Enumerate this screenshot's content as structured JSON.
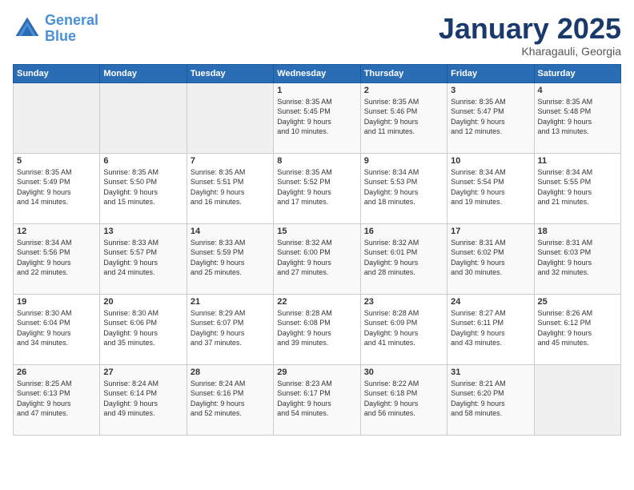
{
  "logo": {
    "line1": "General",
    "line2": "Blue"
  },
  "header": {
    "month": "January 2025",
    "location": "Kharagauli, Georgia"
  },
  "weekdays": [
    "Sunday",
    "Monday",
    "Tuesday",
    "Wednesday",
    "Thursday",
    "Friday",
    "Saturday"
  ],
  "weeks": [
    [
      {
        "day": "",
        "info": ""
      },
      {
        "day": "",
        "info": ""
      },
      {
        "day": "",
        "info": ""
      },
      {
        "day": "1",
        "info": "Sunrise: 8:35 AM\nSunset: 5:45 PM\nDaylight: 9 hours\nand 10 minutes."
      },
      {
        "day": "2",
        "info": "Sunrise: 8:35 AM\nSunset: 5:46 PM\nDaylight: 9 hours\nand 11 minutes."
      },
      {
        "day": "3",
        "info": "Sunrise: 8:35 AM\nSunset: 5:47 PM\nDaylight: 9 hours\nand 12 minutes."
      },
      {
        "day": "4",
        "info": "Sunrise: 8:35 AM\nSunset: 5:48 PM\nDaylight: 9 hours\nand 13 minutes."
      }
    ],
    [
      {
        "day": "5",
        "info": "Sunrise: 8:35 AM\nSunset: 5:49 PM\nDaylight: 9 hours\nand 14 minutes."
      },
      {
        "day": "6",
        "info": "Sunrise: 8:35 AM\nSunset: 5:50 PM\nDaylight: 9 hours\nand 15 minutes."
      },
      {
        "day": "7",
        "info": "Sunrise: 8:35 AM\nSunset: 5:51 PM\nDaylight: 9 hours\nand 16 minutes."
      },
      {
        "day": "8",
        "info": "Sunrise: 8:35 AM\nSunset: 5:52 PM\nDaylight: 9 hours\nand 17 minutes."
      },
      {
        "day": "9",
        "info": "Sunrise: 8:34 AM\nSunset: 5:53 PM\nDaylight: 9 hours\nand 18 minutes."
      },
      {
        "day": "10",
        "info": "Sunrise: 8:34 AM\nSunset: 5:54 PM\nDaylight: 9 hours\nand 19 minutes."
      },
      {
        "day": "11",
        "info": "Sunrise: 8:34 AM\nSunset: 5:55 PM\nDaylight: 9 hours\nand 21 minutes."
      }
    ],
    [
      {
        "day": "12",
        "info": "Sunrise: 8:34 AM\nSunset: 5:56 PM\nDaylight: 9 hours\nand 22 minutes."
      },
      {
        "day": "13",
        "info": "Sunrise: 8:33 AM\nSunset: 5:57 PM\nDaylight: 9 hours\nand 24 minutes."
      },
      {
        "day": "14",
        "info": "Sunrise: 8:33 AM\nSunset: 5:59 PM\nDaylight: 9 hours\nand 25 minutes."
      },
      {
        "day": "15",
        "info": "Sunrise: 8:32 AM\nSunset: 6:00 PM\nDaylight: 9 hours\nand 27 minutes."
      },
      {
        "day": "16",
        "info": "Sunrise: 8:32 AM\nSunset: 6:01 PM\nDaylight: 9 hours\nand 28 minutes."
      },
      {
        "day": "17",
        "info": "Sunrise: 8:31 AM\nSunset: 6:02 PM\nDaylight: 9 hours\nand 30 minutes."
      },
      {
        "day": "18",
        "info": "Sunrise: 8:31 AM\nSunset: 6:03 PM\nDaylight: 9 hours\nand 32 minutes."
      }
    ],
    [
      {
        "day": "19",
        "info": "Sunrise: 8:30 AM\nSunset: 6:04 PM\nDaylight: 9 hours\nand 34 minutes."
      },
      {
        "day": "20",
        "info": "Sunrise: 8:30 AM\nSunset: 6:06 PM\nDaylight: 9 hours\nand 35 minutes."
      },
      {
        "day": "21",
        "info": "Sunrise: 8:29 AM\nSunset: 6:07 PM\nDaylight: 9 hours\nand 37 minutes."
      },
      {
        "day": "22",
        "info": "Sunrise: 8:28 AM\nSunset: 6:08 PM\nDaylight: 9 hours\nand 39 minutes."
      },
      {
        "day": "23",
        "info": "Sunrise: 8:28 AM\nSunset: 6:09 PM\nDaylight: 9 hours\nand 41 minutes."
      },
      {
        "day": "24",
        "info": "Sunrise: 8:27 AM\nSunset: 6:11 PM\nDaylight: 9 hours\nand 43 minutes."
      },
      {
        "day": "25",
        "info": "Sunrise: 8:26 AM\nSunset: 6:12 PM\nDaylight: 9 hours\nand 45 minutes."
      }
    ],
    [
      {
        "day": "26",
        "info": "Sunrise: 8:25 AM\nSunset: 6:13 PM\nDaylight: 9 hours\nand 47 minutes."
      },
      {
        "day": "27",
        "info": "Sunrise: 8:24 AM\nSunset: 6:14 PM\nDaylight: 9 hours\nand 49 minutes."
      },
      {
        "day": "28",
        "info": "Sunrise: 8:24 AM\nSunset: 6:16 PM\nDaylight: 9 hours\nand 52 minutes."
      },
      {
        "day": "29",
        "info": "Sunrise: 8:23 AM\nSunset: 6:17 PM\nDaylight: 9 hours\nand 54 minutes."
      },
      {
        "day": "30",
        "info": "Sunrise: 8:22 AM\nSunset: 6:18 PM\nDaylight: 9 hours\nand 56 minutes."
      },
      {
        "day": "31",
        "info": "Sunrise: 8:21 AM\nSunset: 6:20 PM\nDaylight: 9 hours\nand 58 minutes."
      },
      {
        "day": "",
        "info": ""
      }
    ]
  ]
}
